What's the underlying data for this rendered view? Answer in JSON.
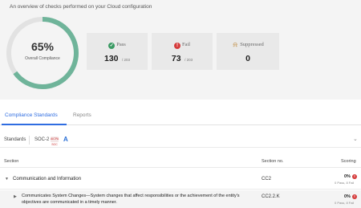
{
  "intro_text": "An overview of checks performed on your Cloud configuration",
  "compliance": {
    "percent_label": "65%",
    "percent_value": 65,
    "label": "Overall Compliance",
    "ring_color": "#6fb49a",
    "track_color": "#e2e2e2"
  },
  "cards": {
    "pass": {
      "label": "Pass",
      "value": "130",
      "total": "/ 203",
      "icon": "check-circle-icon",
      "color": "#3a9a63"
    },
    "fail": {
      "label": "Fail",
      "value": "73",
      "total": "/ 203",
      "icon": "exclamation-circle-icon",
      "color": "#d53b3b"
    },
    "suppressed": {
      "label": "Suppressed",
      "value": "0",
      "icon": "bell-off-icon",
      "color": "#c9a065"
    }
  },
  "tabs": {
    "compliance_standards": "Compliance Standards",
    "reports": "Reports",
    "accent": "#2f6de1"
  },
  "standards_bar": {
    "label": "Standards",
    "selected": "SOC-2",
    "logo1_text": "AICPA SOC",
    "logo2_text": "A"
  },
  "table": {
    "headers": {
      "section": "Section",
      "section_no": "Section no.",
      "scoring": "Scoring"
    },
    "rows": [
      {
        "title": "Communication and Information",
        "section_no": "CC2",
        "score": "0%",
        "score_sub": "0 Pass, 8 Fail"
      },
      {
        "title": "Communicates System Changes—System changes that affect responsibilities or the achievement of the entity's objectives are communicated in a timely manner.",
        "section_no": "CC2.2.K",
        "score": "0%",
        "score_sub": "0 Pass, 8 Fail"
      }
    ]
  }
}
